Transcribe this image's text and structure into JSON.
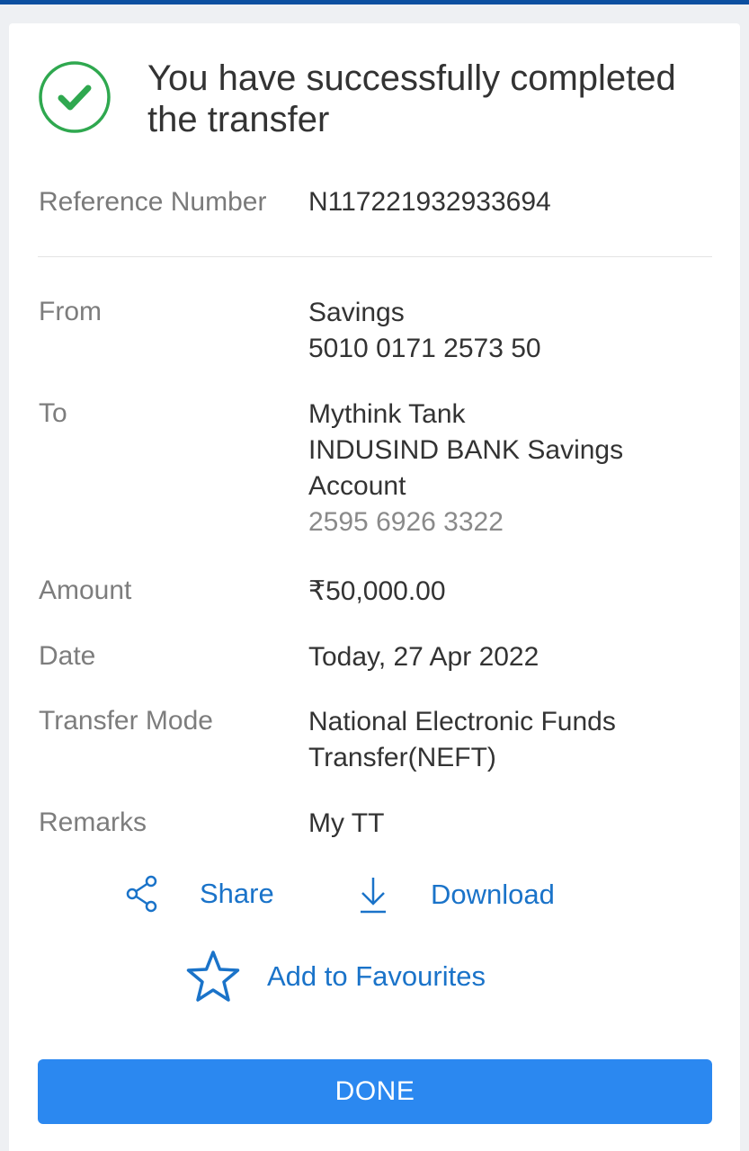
{
  "header": {
    "title_line1": "You have successfully completed",
    "title_line2": "the transfer"
  },
  "reference": {
    "label": "Reference Number",
    "value": "N117221932933694"
  },
  "details": {
    "from": {
      "label": "From",
      "account_type": "Savings",
      "account_number": "5010 0171 2573 50"
    },
    "to": {
      "label": "To",
      "name": "Mythink Tank",
      "bank_line1": "INDUSIND BANK Savings",
      "bank_line2": "Account",
      "account_number": "2595 6926 3322"
    },
    "amount": {
      "label": "Amount",
      "value": "₹50,000.00"
    },
    "date": {
      "label": "Date",
      "value": "Today, 27 Apr 2022"
    },
    "mode": {
      "label": "Transfer Mode",
      "value_line1": "National Electronic Funds",
      "value_line2": "Transfer(NEFT)"
    },
    "remarks": {
      "label": "Remarks",
      "value": "My TT"
    }
  },
  "actions": {
    "share_label": "Share",
    "download_label": "Download",
    "favourite_label": "Add to Favourites"
  },
  "footer": {
    "done_label": "DONE"
  },
  "icons": {
    "success": "check-circle-icon",
    "share": "share-icon",
    "download": "download-icon",
    "favourite": "star-icon"
  },
  "colors": {
    "accent": "#1a73c9",
    "button": "#2b88f0",
    "success": "#2fa84f",
    "topbar": "#0b4fa0"
  }
}
